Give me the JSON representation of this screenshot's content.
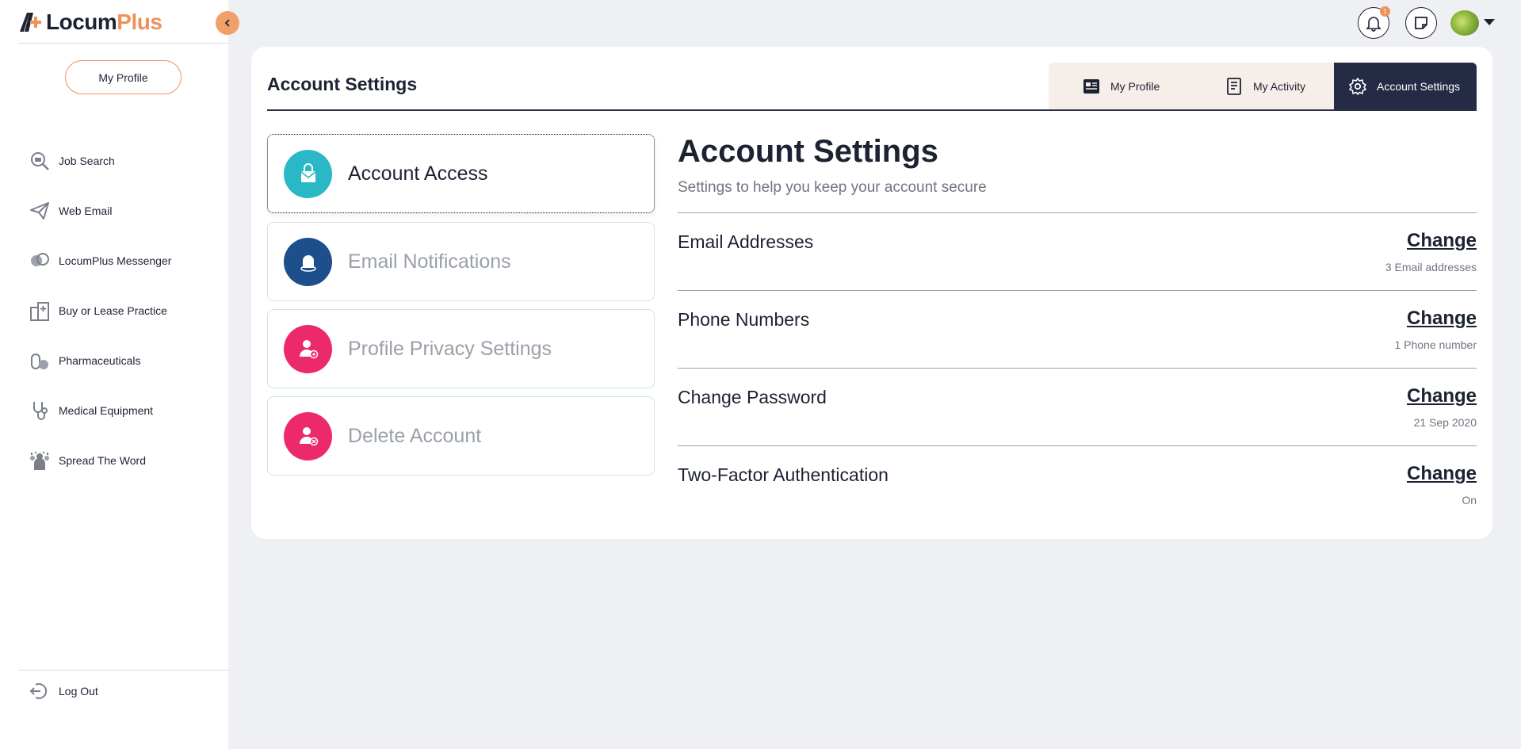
{
  "brand": {
    "name_part1": "Locum",
    "name_part2": "Plus"
  },
  "sidebar": {
    "profile_button": "My Profile",
    "items": [
      {
        "label": "Job Search",
        "icon": "job-search-icon"
      },
      {
        "label": "Web Email",
        "icon": "paper-plane-icon"
      },
      {
        "label": "LocumPlus Messenger",
        "icon": "chat-bubbles-icon"
      },
      {
        "label": "Buy or Lease Practice",
        "icon": "hospital-building-icon"
      },
      {
        "label": "Pharmaceuticals",
        "icon": "pills-icon"
      },
      {
        "label": "Medical Equipment",
        "icon": "stethoscope-icon"
      },
      {
        "label": "Spread The Word",
        "icon": "people-group-icon"
      }
    ],
    "logout": "Log Out"
  },
  "header": {
    "notification_count": "1"
  },
  "page": {
    "title": "Account Settings",
    "tabs": [
      {
        "label": "My Profile",
        "icon": "profile-card-icon"
      },
      {
        "label": "My Activity",
        "icon": "document-list-icon"
      },
      {
        "label": "Account Settings",
        "icon": "gear-icon",
        "active": true
      }
    ],
    "menu": [
      {
        "label": "Account Access",
        "icon": "lock-envelope-icon",
        "color": "#2ab7c6",
        "active": true
      },
      {
        "label": "Email Notifications",
        "icon": "bell-icon",
        "color": "#1c4f8c"
      },
      {
        "label": "Profile Privacy Settings",
        "icon": "user-privacy-icon",
        "color": "#ec2a6b"
      },
      {
        "label": "Delete Account",
        "icon": "user-delete-icon",
        "color": "#ec2a6b"
      }
    ]
  },
  "content": {
    "title": "Account Settings",
    "subtitle": "Settings to help you keep your account secure",
    "rows": [
      {
        "label": "Email Addresses",
        "action": "Change",
        "meta": "3 Email addresses"
      },
      {
        "label": "Phone Numbers",
        "action": "Change",
        "meta": "1 Phone number"
      },
      {
        "label": "Change Password",
        "action": "Change",
        "meta": "21 Sep 2020"
      },
      {
        "label": "Two-Factor Authentication",
        "action": "Change",
        "meta": "On"
      }
    ]
  },
  "colors": {
    "accent": "#f0915a",
    "dark": "#262b45",
    "teal": "#2ab7c6",
    "navy": "#1c4f8c",
    "pink": "#ec2a6b"
  }
}
